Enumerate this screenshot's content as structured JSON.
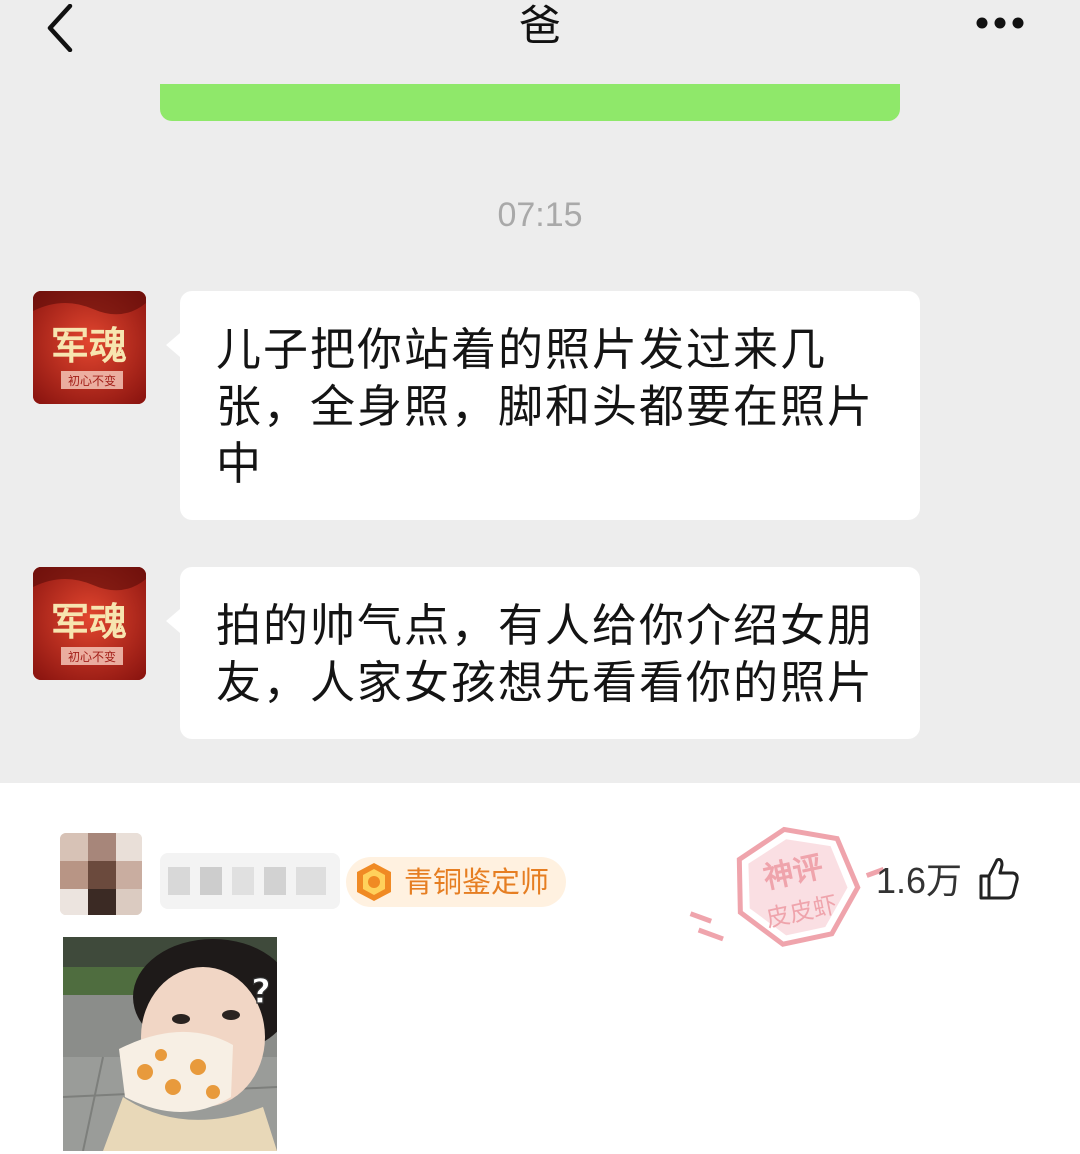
{
  "header": {
    "title": "爸"
  },
  "chat": {
    "timestamp": "07:15",
    "messages": [
      {
        "avatar_text": "军魂",
        "avatar_subtext": "初心不变",
        "text": "儿子把你站着的照片发过来几张，全身照，脚和头都要在照片中"
      },
      {
        "avatar_text": "军魂",
        "avatar_subtext": "初心不变",
        "text": "拍的帅气点，有人给你介绍女朋友，人家女孩想先看看你的照片"
      }
    ]
  },
  "comment": {
    "badge_label": "青铜鉴定师",
    "like_count": "1.6万",
    "watermark_line1": "神评",
    "watermark_line2": "皮皮虾"
  },
  "colors": {
    "chat_bg": "#ededed",
    "banner_green": "#8fe86a",
    "badge_orange": "#e67e22",
    "avatar_red": "#b3261e",
    "watermark_red": "#e35a6a"
  },
  "icons": [
    "back-arrow-icon",
    "more-dots-icon",
    "badge-medal-icon",
    "thumbs-up-icon"
  ]
}
